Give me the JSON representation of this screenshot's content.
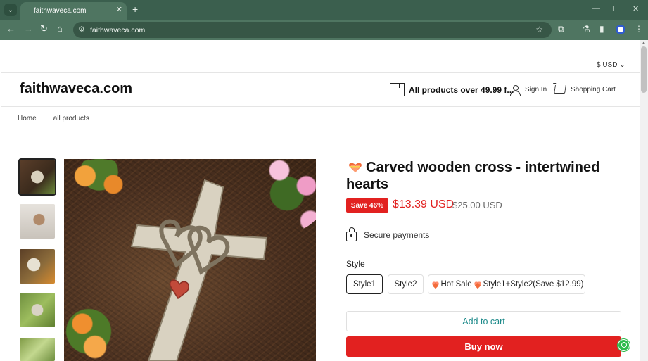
{
  "browser": {
    "tab_title": "faithwaveca.com",
    "url": "faithwaveca.com",
    "newtab_symbol": "+",
    "close_symbol": "✕",
    "back_symbol": "←",
    "forward_symbol": "→",
    "reload_symbol": "↻",
    "home_symbol": "⌂",
    "star_symbol": "☆",
    "minimize_symbol": "—",
    "maximize_symbol": "☐",
    "window_close_symbol": "✕",
    "menu_symbol": "⋮"
  },
  "header": {
    "currency": "$ USD ⌄",
    "site_title": "faithwaveca.com",
    "promo": "All products over 49.99 f...",
    "sign_in": "Sign In",
    "cart": "Shopping Cart"
  },
  "breadcrumb": {
    "home": "Home",
    "all_products": "all products"
  },
  "product": {
    "title": "Carved wooden cross - intertwined hearts",
    "badge": "Save 46%",
    "price": "$13.39 USD",
    "compare_price": "$25.00 USD",
    "secure": "Secure payments",
    "style_label": "Style",
    "options": [
      {
        "label": "Style1",
        "selected": true
      },
      {
        "label": "Style2",
        "selected": false
      },
      {
        "label_pre": "Hot Sale",
        "label_post": "Style1+Style2(Save $12.99)",
        "selected": false
      }
    ],
    "add_to_cart": "Add to cart",
    "buy_now": "Buy now"
  },
  "colors": {
    "accent_red": "#e22120",
    "teal_text": "#1d8a8a",
    "chrome_green": "#4f7561"
  }
}
